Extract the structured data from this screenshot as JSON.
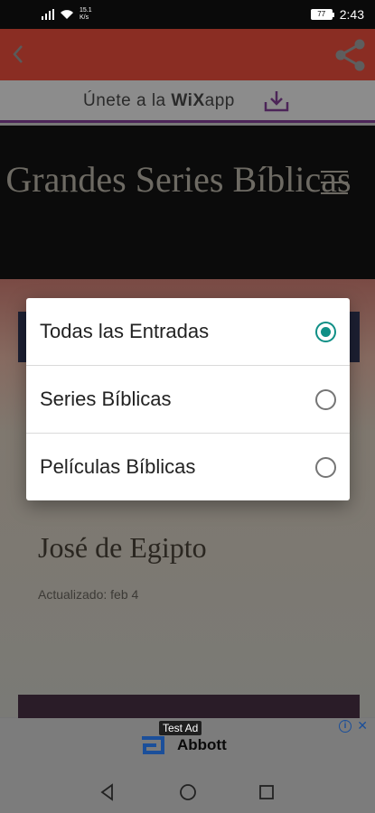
{
  "status_bar": {
    "net_speed": "15.1\nK/s",
    "battery": "77",
    "time": "2:43"
  },
  "wix_banner": {
    "prefix": "Únete a la ",
    "brand": "WiX",
    "suffix": "app"
  },
  "hero": {
    "title": "Grandes Series Bíblicas"
  },
  "post": {
    "title": "José de Egipto",
    "meta": "Actualizado: feb 4"
  },
  "ad": {
    "label": "Test Ad",
    "brand": "Abbott"
  },
  "dialog": {
    "options": [
      {
        "label": "Todas las Entradas",
        "selected": true
      },
      {
        "label": "Series Bíblicas",
        "selected": false
      },
      {
        "label": "Películas Bíblicas",
        "selected": false
      }
    ]
  },
  "colors": {
    "accent": "#0f8f86",
    "appbar": "#8a2d23",
    "wix_underline": "#4c2558"
  }
}
